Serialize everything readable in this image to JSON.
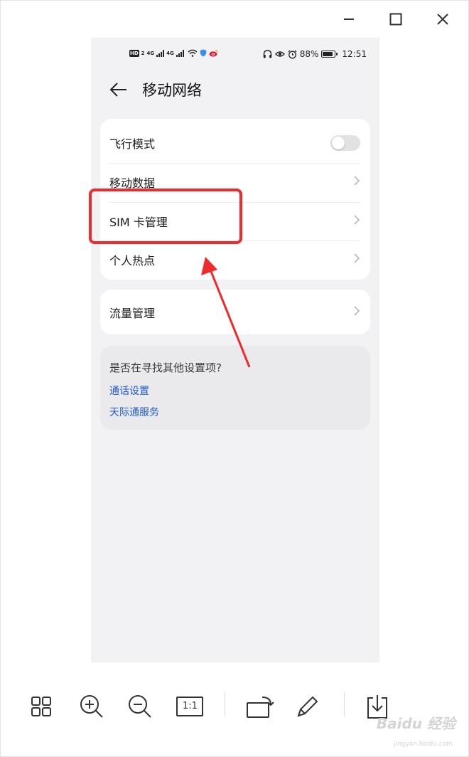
{
  "window": {
    "controls": [
      "minimize",
      "maximize",
      "close"
    ]
  },
  "status_bar": {
    "network_labels": [
      "HD",
      "2",
      "4G",
      "4G"
    ],
    "battery": "88%",
    "battery_level": 0.88,
    "time": "12:51"
  },
  "header": {
    "title": "移动网络"
  },
  "settings": {
    "items": [
      {
        "label": "飞行模式",
        "control": "toggle",
        "enabled": false
      },
      {
        "label": "移动数据",
        "control": "chevron"
      },
      {
        "label": "SIM 卡管理",
        "control": "chevron"
      },
      {
        "label": "个人热点",
        "control": "chevron"
      }
    ],
    "data_item": {
      "label": "流量管理",
      "control": "chevron"
    }
  },
  "suggest": {
    "title": "是否在寻找其他设置项?",
    "links": [
      "通话设置",
      "天际通服务"
    ]
  },
  "toolbar": {
    "one_to_one": "1:1"
  },
  "watermark": {
    "text": "Baidu 经验",
    "sub": "jingyan.baidu.com"
  },
  "colors": {
    "accent_link": "#1d58c9",
    "annotation": "#ee2a2a",
    "screen_bg": "#f2f2f4"
  }
}
